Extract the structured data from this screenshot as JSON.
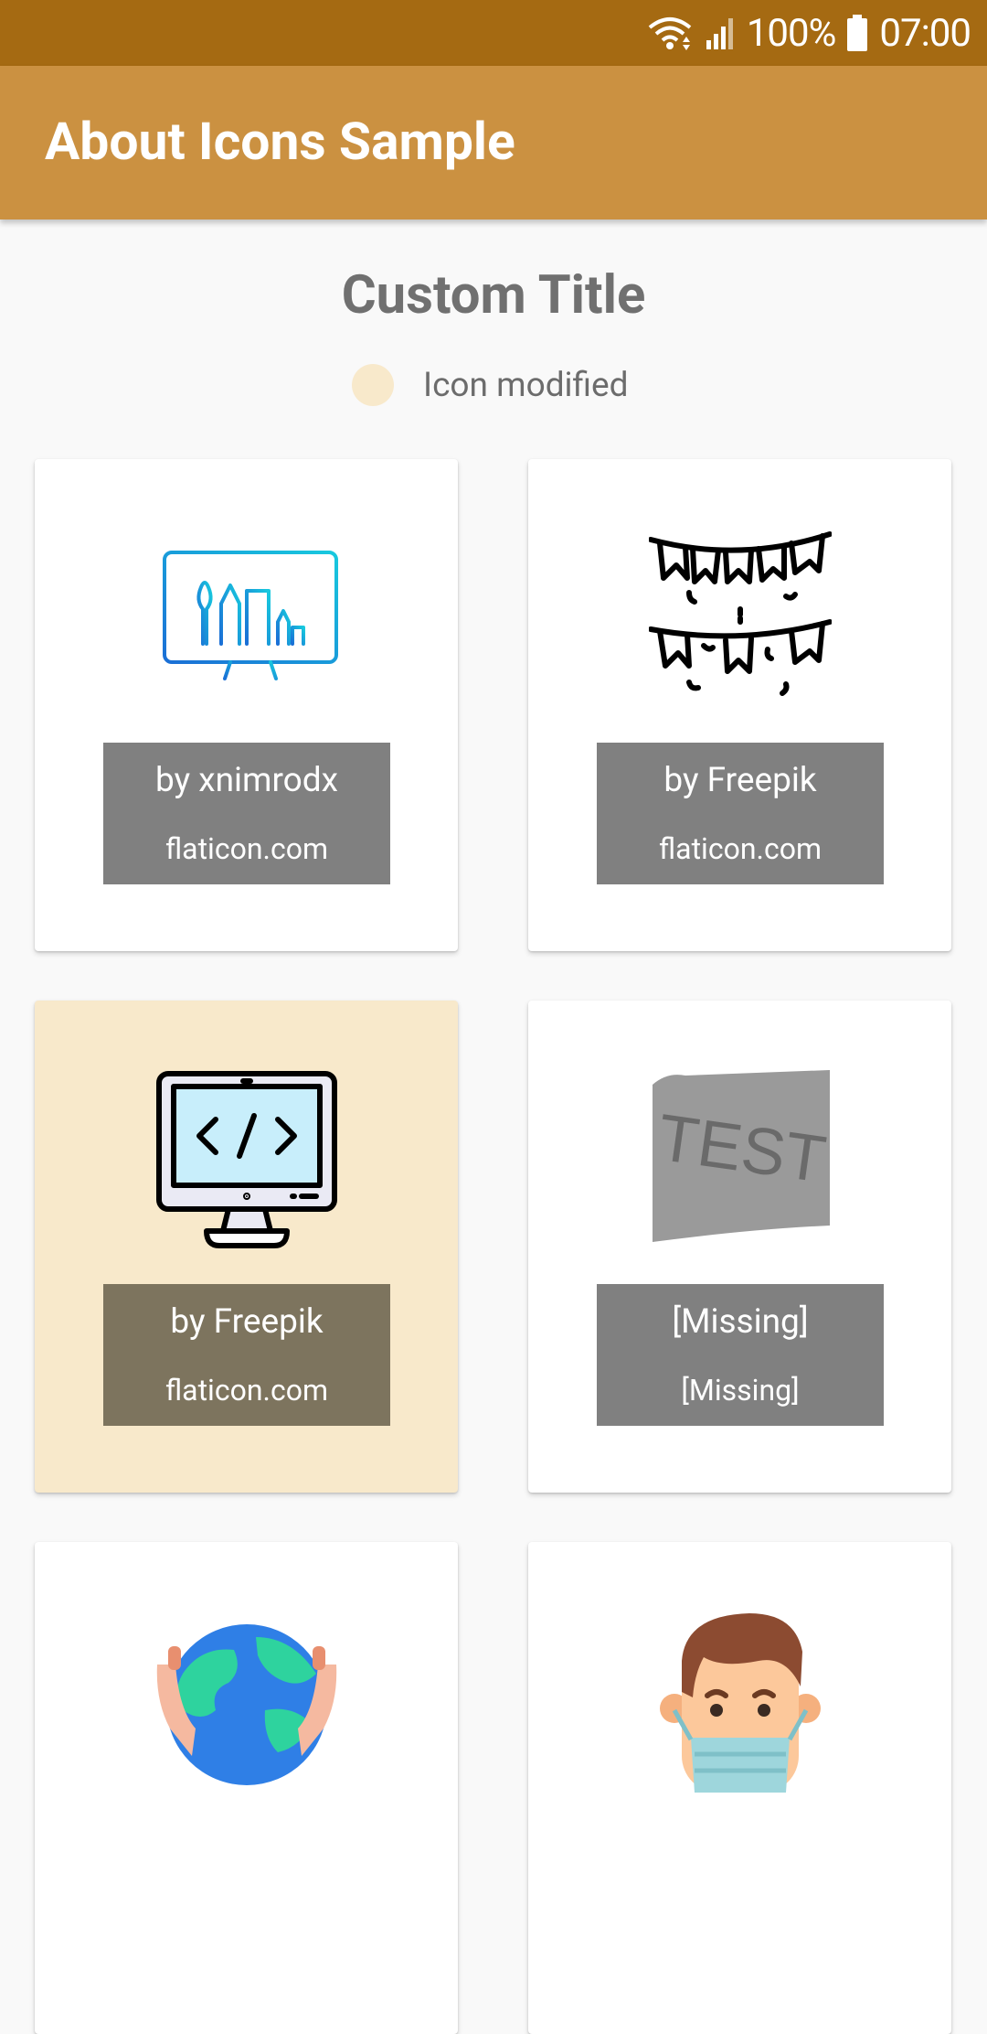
{
  "status_bar": {
    "battery": "100%",
    "time": "07:00",
    "background_color": "#a56a12"
  },
  "app_bar": {
    "title": "About Icons Sample",
    "background_color": "#cb9141"
  },
  "header": {
    "title": "Custom Title",
    "legend_label": "Icon modified",
    "legend_color": "#f8e9cb"
  },
  "cards": [
    {
      "icon": "monitor-art-tools-icon",
      "author": "by xnimrodx",
      "site": "flaticon.com",
      "modified": false
    },
    {
      "icon": "party-bunting-icon",
      "author": "by Freepik",
      "site": "flaticon.com",
      "modified": false
    },
    {
      "icon": "monitor-code-icon",
      "author": "by Freepik",
      "site": "flaticon.com",
      "modified": true
    },
    {
      "icon": "test-placeholder-icon",
      "author": "[Missing]",
      "site": "[Missing]",
      "modified": false
    },
    {
      "icon": "globe-in-hands-icon",
      "author": "",
      "site": "",
      "modified": false
    },
    {
      "icon": "man-with-mask-icon",
      "author": "",
      "site": "",
      "modified": false
    }
  ],
  "test_placeholder_text": "TEST"
}
